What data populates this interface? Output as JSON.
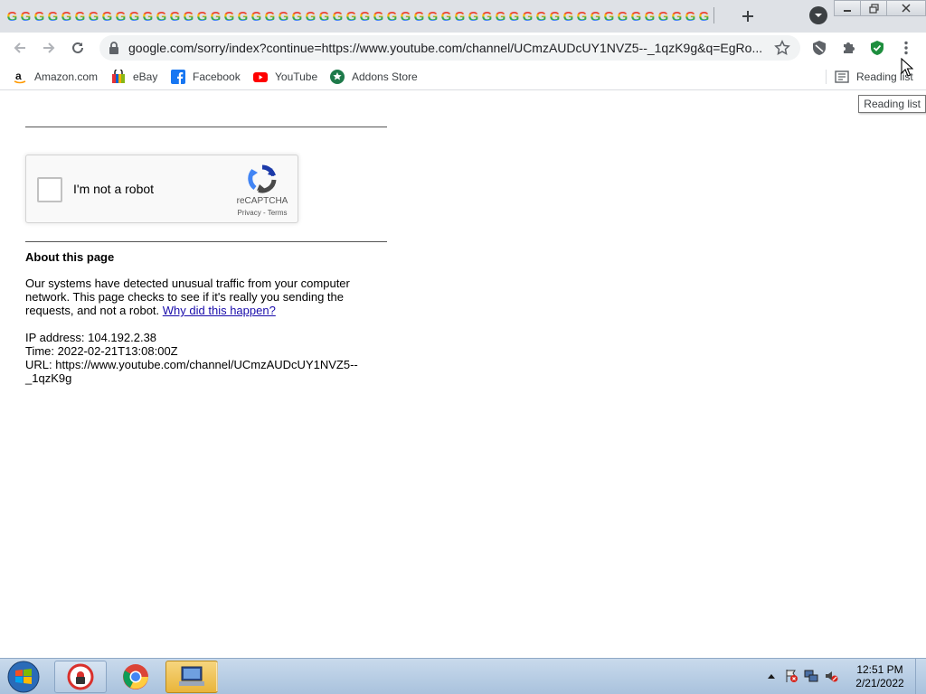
{
  "browser": {
    "tab_favicon_letter": "G",
    "tab_count": 52,
    "url": "google.com/sorry/index?continue=https://www.youtube.com/channel/UCmzAUDcUY1NVZ5--_1qzK9g&q=EgRo...",
    "bookmarks": [
      {
        "label": "Amazon.com",
        "icon": "amazon-icon"
      },
      {
        "label": "eBay",
        "icon": "ebay-icon"
      },
      {
        "label": "Facebook",
        "icon": "facebook-icon"
      },
      {
        "label": "YouTube",
        "icon": "youtube-icon"
      },
      {
        "label": "Addons Store",
        "icon": "addons-store-icon"
      }
    ],
    "reading_list_label": "Reading list",
    "tooltip": "Reading list"
  },
  "page": {
    "recaptcha": {
      "label": "I'm not a robot",
      "brand": "reCAPTCHA",
      "privacy": "Privacy",
      "link_sep": " - ",
      "terms": "Terms"
    },
    "about_heading": "About this page",
    "description": "Our systems have detected unusual traffic from your computer network. This page checks to see if it's really you sending the requests, and not a robot.",
    "why_link": "Why did this happen?",
    "ip_line": "IP address: 104.192.2.38",
    "time_line": "Time: 2022-02-21T13:08:00Z",
    "url_line_1": "URL: https://www.youtube.com/channel/UCmzAUDcUY1NVZ5--",
    "url_line_2": "_1qzK9g"
  },
  "taskbar": {
    "time": "12:51 PM",
    "date": "2/21/2022"
  },
  "colors": {
    "tabstrip_bg": "#dee1e6",
    "omnibox_bg": "#f1f3f4",
    "link": "#1a0dab",
    "taskbar_bg": "#b9cfe6"
  }
}
